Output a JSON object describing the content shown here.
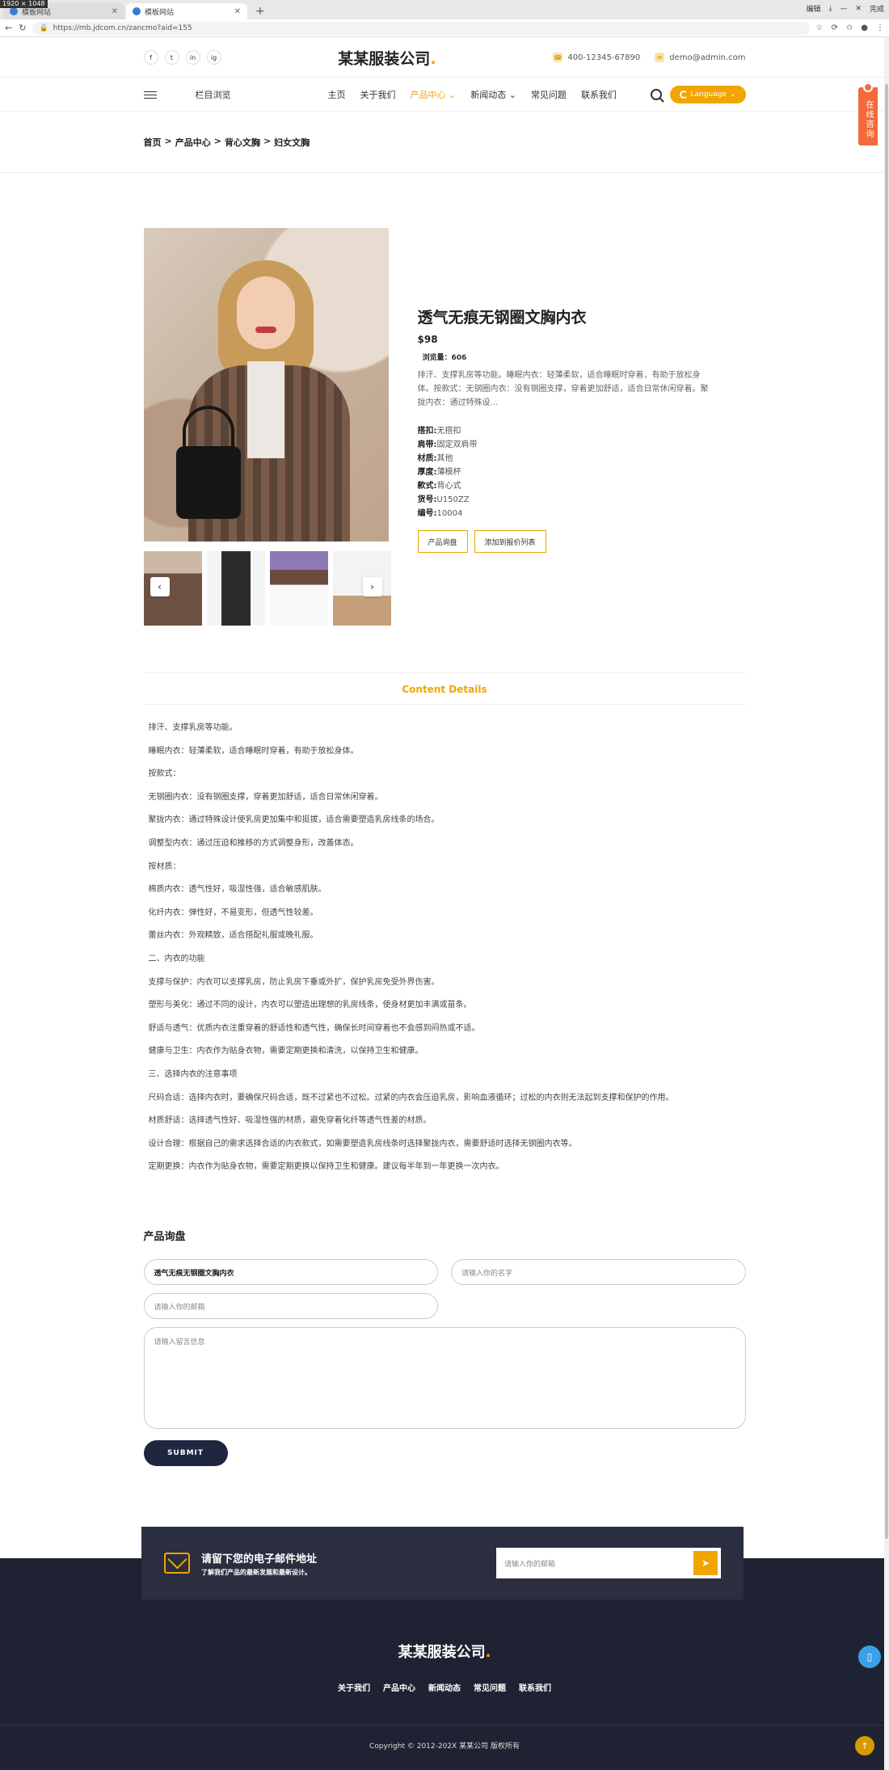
{
  "browser": {
    "resolution_badge": "1920 × 1048",
    "tabs": [
      {
        "title": "模板网站"
      },
      {
        "title": "模板网站"
      }
    ],
    "new_tab": "+",
    "close": "✕",
    "url": "https://mb.jdcom.cn/zancmo?aid=155",
    "window_actions": [
      "编辑",
      "完成"
    ]
  },
  "header": {
    "logo": "某某服装公司",
    "logo_dot": ".",
    "socials": [
      "f",
      "t",
      "in",
      "ig"
    ],
    "phone": "400-12345-67890",
    "email": "demo@admin.com"
  },
  "nav": {
    "browse": "栏目浏览",
    "items": [
      "主页",
      "关于我们",
      "产品中心",
      "新闻动态",
      "常见问题",
      "联系我们"
    ],
    "language": "Language"
  },
  "side_consult": "在线咨询",
  "breadcrumb": [
    "首页",
    ">",
    "产品中心",
    ">",
    "背心文胸",
    ">",
    "妇女文胸"
  ],
  "product": {
    "title": "透气无痕无钢圈文胸内衣",
    "price": "$98",
    "views_label": "浏览量：",
    "views": "606",
    "description": "排汗、支撑乳房等功能。睡眠内衣：轻薄柔软，适合睡眠时穿着，有助于放松身体。按款式：无钢圈内衣：没有钢圈支撑，穿着更加舒适，适合日常休闲穿着。聚拢内衣：通过特殊设...",
    "attributes": [
      {
        "label": "搭扣:",
        "value": "无搭扣"
      },
      {
        "label": "肩带:",
        "value": "固定双肩带"
      },
      {
        "label": "材质:",
        "value": "其他"
      },
      {
        "label": "厚度:",
        "value": "薄模杯"
      },
      {
        "label": "款式:",
        "value": "背心式"
      },
      {
        "label": "货号:",
        "value": "U150ZZ"
      },
      {
        "label": "编号:",
        "value": "10004"
      }
    ],
    "buttons": [
      "产品询盘",
      "添加到报价列表"
    ],
    "arrow_prev": "‹",
    "arrow_next": "›"
  },
  "details": {
    "tab": "Content Details",
    "paragraphs": [
      "排汗、支撑乳房等功能。",
      "睡眠内衣：轻薄柔软，适合睡眠时穿着，有助于放松身体。",
      "按款式：",
      "无钢圈内衣：没有钢圈支撑，穿着更加舒适，适合日常休闲穿着。",
      "聚拢内衣：通过特殊设计使乳房更加集中和挺拔，适合需要塑造乳房线条的场合。",
      "调整型内衣：通过压迫和推移的方式调整身形，改善体态。",
      "按材质：",
      "棉质内衣：透气性好，吸湿性强，适合敏感肌肤。",
      "化纤内衣：弹性好，不易变形，但透气性较差。",
      "蕾丝内衣：外观精致，适合搭配礼服或晚礼服。",
      "二、内衣的功能",
      "支撑与保护：内衣可以支撑乳房，防止乳房下垂或外扩，保护乳房免受外界伤害。",
      "塑形与美化：通过不同的设计，内衣可以塑造出理想的乳房线条，使身材更加丰满或苗条。",
      "舒适与透气：优质内衣注重穿着的舒适性和透气性，确保长时间穿着也不会感到闷热或不适。",
      "健康与卫生：内衣作为贴身衣物，需要定期更换和清洗，以保持卫生和健康。",
      "三、选择内衣的注意事项",
      "尺码合适：选择内衣时，要确保尺码合适，既不过紧也不过松。过紧的内衣会压迫乳房，影响血液循环；过松的内衣则无法起到支撑和保护的作用。",
      "材质舒适：选择透气性好、吸湿性强的材质，避免穿着化纤等透气性差的材质。",
      "设计合理：根据自己的需求选择合适的内衣款式，如需要塑造乳房线条时选择聚拢内衣，需要舒适时选择无钢圈内衣等。",
      "定期更换：内衣作为贴身衣物，需要定期更换以保持卫生和健康。建议每半年到一年更换一次内衣。"
    ]
  },
  "inquiry": {
    "title": "产品询盘",
    "product_value": "透气无痕无钢圈文胸内衣",
    "name_placeholder": "请输入你的名字",
    "email_placeholder": "请输入你的邮箱",
    "message_placeholder": "请输入留言信息",
    "submit": "SUBMIT"
  },
  "newsletter": {
    "title": "请留下您的电子邮件地址",
    "subtitle": "了解我们产品的最新发展和最新设计。",
    "placeholder": "请输入你的邮箱"
  },
  "footer": {
    "logo": "某某服装公司",
    "logo_dot": ".",
    "links": [
      "关于我们",
      "产品中心",
      "新闻动态",
      "常见问题",
      "联系我们"
    ],
    "copyright": "Copyright © 2012-202X 某某公司 版权所有"
  },
  "colors": {
    "accent": "#f0a500",
    "footer_bg": "#1f2232",
    "consult": "#f26b3a"
  }
}
